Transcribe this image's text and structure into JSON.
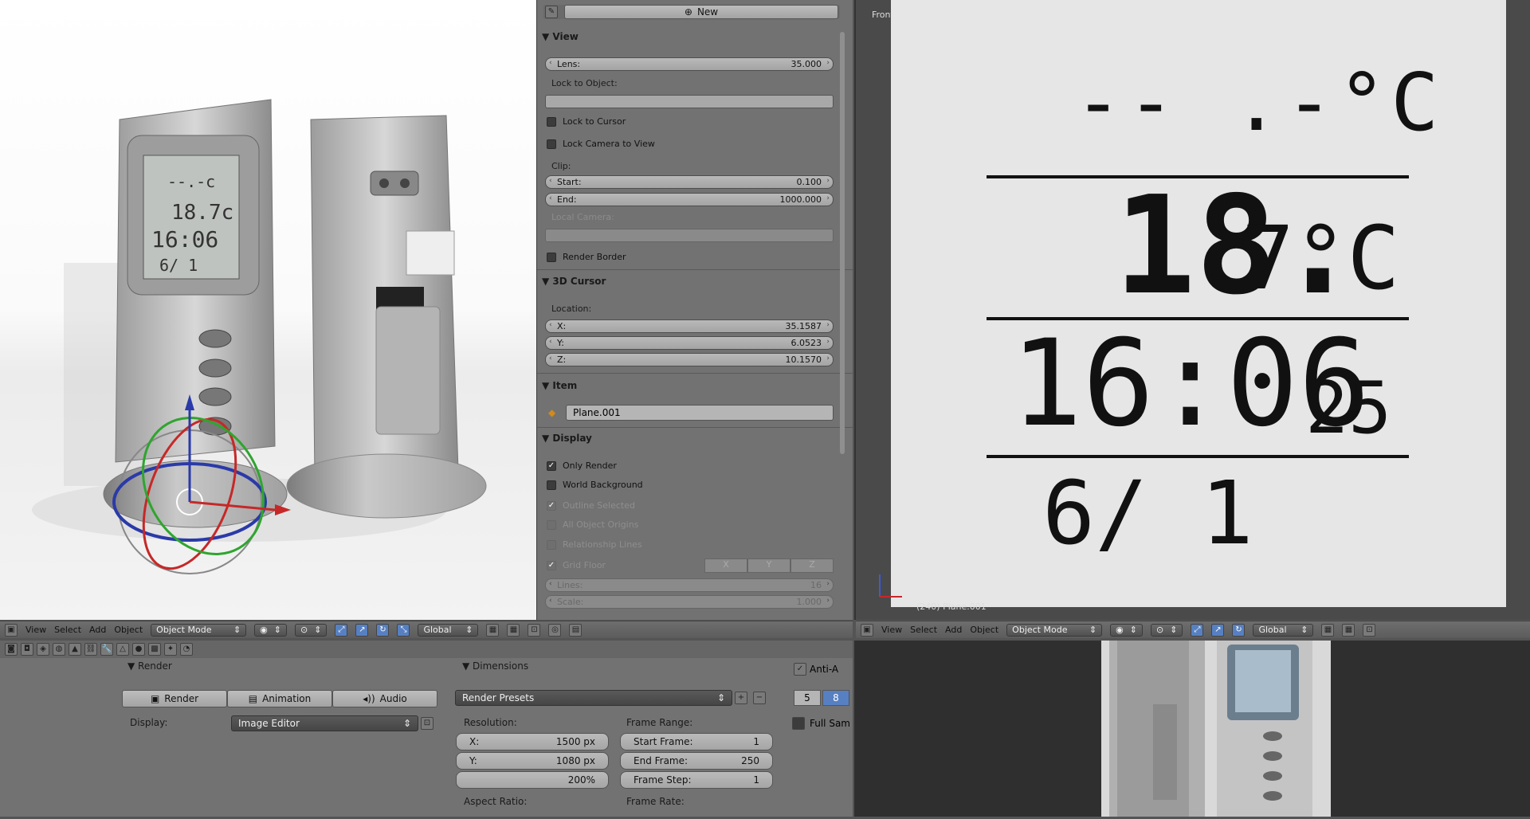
{
  "props": {
    "new_button": "New",
    "view_header": "▼ View",
    "lens_label": "Lens:",
    "lens_value": "35.000",
    "lock_to_object_label": "Lock to Object:",
    "lock_to_cursor": "Lock to Cursor",
    "lock_camera_to_view": "Lock Camera to View",
    "clip_label": "Clip:",
    "clip_start_label": "Start:",
    "clip_start_value": "0.100",
    "clip_end_label": "End:",
    "clip_end_value": "1000.000",
    "local_camera_label": "Local Camera:",
    "render_border": "Render Border",
    "cursor_header": "▼ 3D Cursor",
    "location_label": "Location:",
    "x_label": "X:",
    "x_value": "35.1587",
    "y_label": "Y:",
    "y_value": "6.0523",
    "z_label": "Z:",
    "z_value": "10.1570",
    "item_header": "▼ Item",
    "item_name": "Plane.001",
    "display_header": "▼ Display",
    "only_render": "Only Render",
    "world_background": "World Background",
    "outline_selected": "Outline Selected",
    "all_object_origins": "All Object Origins",
    "relationship_lines": "Relationship Lines",
    "grid_floor": "Grid Floor",
    "grid_x": "X",
    "grid_y": "Y",
    "grid_z": "Z",
    "lines_label": "Lines:",
    "lines_value": "16",
    "scale_label": "Scale:",
    "scale_value": "1.000"
  },
  "viewport_right": {
    "title": "Front Ortho",
    "lcd_line1": "-- .-°C",
    "lcd_temp": "18.",
    "lcd_temp_small": "7°C",
    "lcd_time": "16:06",
    "lcd_seconds": "25",
    "lcd_date": "6/ 1",
    "footer": "(240) Plane.001"
  },
  "header_left": {
    "menu": [
      "View",
      "Select",
      "Add",
      "Object"
    ],
    "mode": "Object Mode",
    "orientation": "Global"
  },
  "header_right": {
    "menu": [
      "View",
      "Select",
      "Add",
      "Object"
    ],
    "mode": "Object Mode",
    "orientation": "Global"
  },
  "render": {
    "render_header": "▼ Render",
    "render_btn": "Render",
    "animation_btn": "Animation",
    "audio_btn": "Audio",
    "display_label": "Display:",
    "display_value": "Image Editor",
    "dimensions_header": "▼ Dimensions",
    "presets": "Render Presets",
    "resolution_label": "Resolution:",
    "res_x_label": "X:",
    "res_x_value": "1500 px",
    "res_y_label": "Y:",
    "res_y_value": "1080 px",
    "res_pct": "200%",
    "aspect_label": "Aspect Ratio:",
    "frame_range_label": "Frame Range:",
    "start_label": "Start Frame:",
    "start_value": "1",
    "end_label": "End Frame:",
    "end_value": "250",
    "step_label": "Frame Step:",
    "step_value": "1",
    "frame_rate_label": "Frame Rate:",
    "aa_header": "Anti-A",
    "aa_5": "5",
    "aa_8": "8",
    "full_sample": "Full Sam"
  },
  "colors": {
    "accent": "#5680c2",
    "panel": "#727272",
    "lcd_bg": "#e6e6e6"
  }
}
